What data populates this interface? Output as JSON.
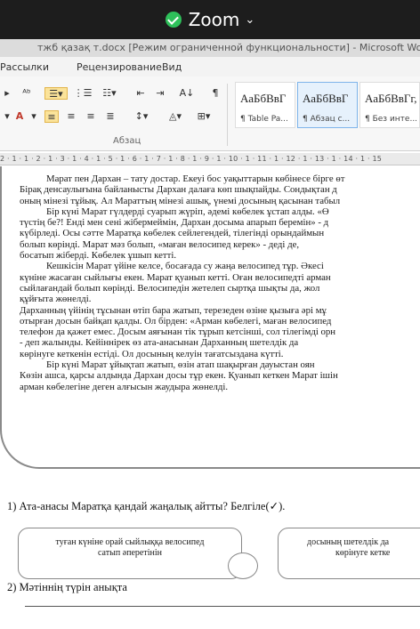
{
  "zoom": {
    "label": "Zoom",
    "chevron": "⌄"
  },
  "window": {
    "title": "тжб қазақ т.docx [Режим ограниченной функциональности] - Microsoft Word"
  },
  "ribbon_tabs": [
    "Рассылки",
    "Рецензирование",
    "Вид"
  ],
  "ribbon": {
    "group_label": "Абзац",
    "styles": [
      {
        "sample": "АаБбВвГ",
        "name": "¶ Table Pa..."
      },
      {
        "sample": "АаБбВвГ",
        "name": "¶ Абзац с..."
      },
      {
        "sample": "АаБбВвГг,",
        "name": "¶ Без инте..."
      }
    ]
  },
  "ruler": {
    "ticks": "2 · 1 · 1 · 2 · 1 · 3 · 1 · 4 · 1 · 5 · 1 · 6 · 1 · 7 · 1 · 8 · 1 · 9 · 1 · 10 · 1 · 11 · 1 · 12 · 1 · 13 · 1 · 14 · 1 · 15"
  },
  "document": {
    "lines": [
      "Марат пен Дархан – тату достар. Екеуі бос уақыттарын көбінесе бірге өт",
      "Бірақ денсаулығына байланысты Дархан далаға көп шықпайды. Сондықтан д",
      "оның мінезі тұйық. Ал Мараттың мінезі ашық, үнемі досының қасынан табыл",
      "Бір күні Марат гүлдерді суарып жүріп, әдемі көбелек ұстап алды. «Ө",
      "түстің бе?! Енді мен сені жібермеймін, Дархан досыма апарып беремін» - д",
      "күбірледі. Осы сәтте Маратқа көбелек сейлегендей, тілегінді орындаймын",
      "болып көрінді. Марат мәз болып, «маған велосипед керек» - деді де,",
      "босатып жіберді. Көбелек ұшып кетті.",
      "Кешкісін Марат үйіне келсе, босағада су жаңа велосипед тұр. Әкесі",
      "күніне жасаған сыйлығы екен. Марат қуанып кетті. Оған велосипедті арман",
      "сыйлағандай болып көрінді. Велосипедін жетелеп сыртқа шықты да, жол",
      "құйғыта жөнелді.",
      "Дарханның үйінің тұсынан өтіп бара жатып, терезеден өзіне қызыға әрі мұ",
      "отырған досын байқап қалды. Ол бірден: «Арман көбелегі, маған велосипед",
      "телефон да қажет емес. Досым аяғынан тік тұрып кетсінші, сол тілегімді орн",
      "- деп жалынды. Кейіннірек өз ата-анасынан Дарханның шетелдік да",
      "көрінуге кеткенін естіді. Ол досының келуін тағатсыздана күтті.",
      "Бір күні Марат ұйықтап жатып, өзін атап шақырған дауыстан оян",
      "Көзін ашса, қарсы алдында Дархан досы тұр екен. Қуанып кеткен Марат ішін",
      "арман көбелегіне деген алғысын жаудыра жөнелді."
    ],
    "indented": [
      0,
      3,
      8,
      17
    ]
  },
  "questions": [
    {
      "text": "1)  Ата-анасы Маратқа қандай жаңалық айтты? Белгіле(✓)."
    },
    {
      "text": "2)  Мәтіннің түрін анықта"
    }
  ],
  "answers": [
    {
      "line1": "туған күніне орай сыйлыққа велосипед",
      "line2": "сатып әперетінін"
    },
    {
      "line1": "досының шетелдік да",
      "line2": "көрінуге кетке"
    }
  ]
}
